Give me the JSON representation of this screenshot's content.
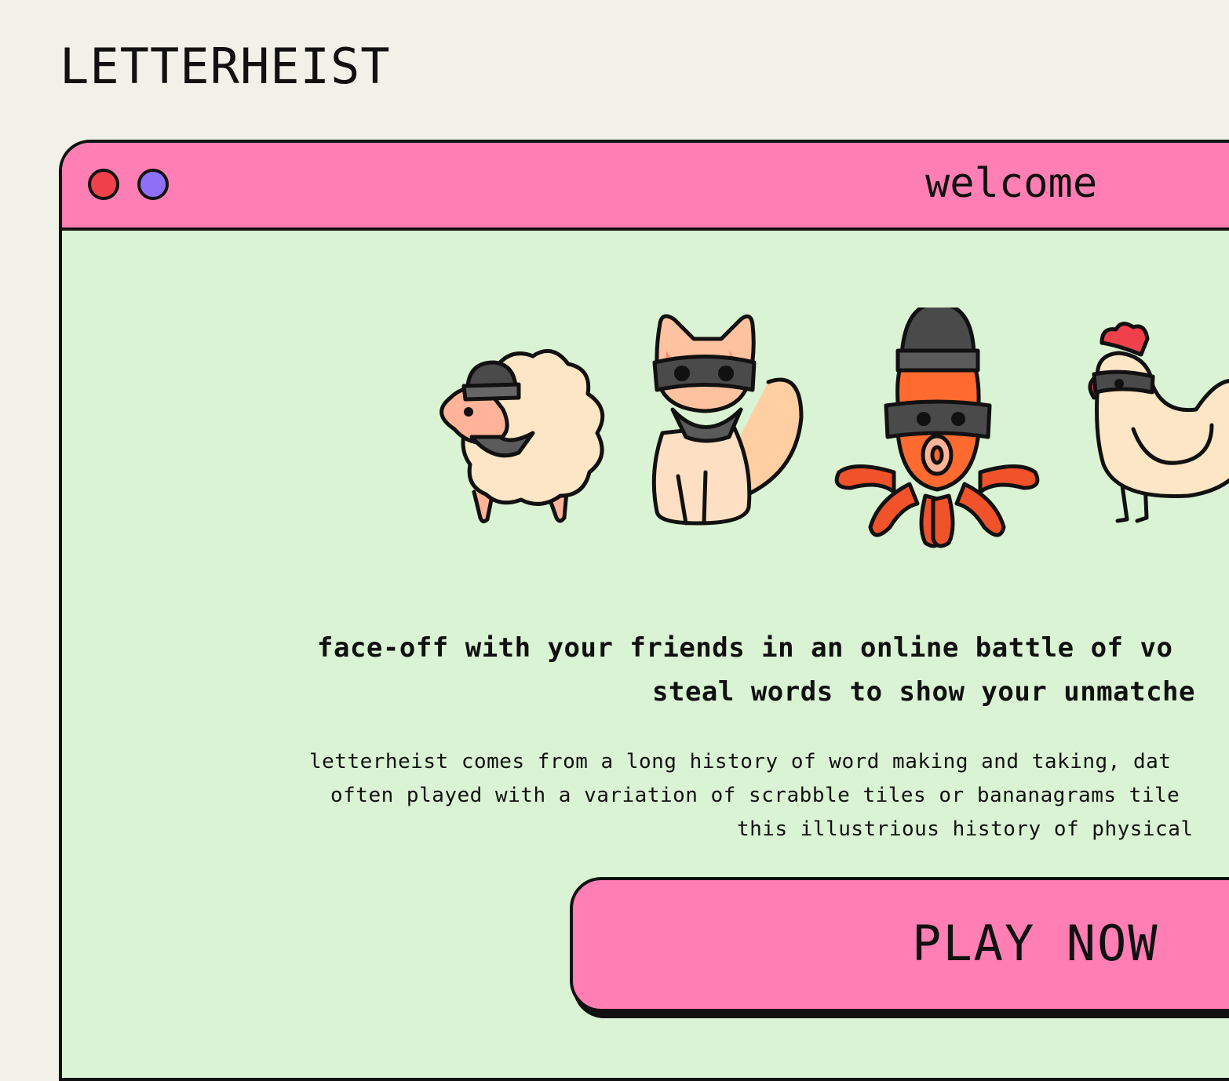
{
  "brand": "LETTERHEIST",
  "window": {
    "title": "welcome",
    "dots": [
      {
        "name": "close",
        "color": "#f0404b"
      },
      {
        "name": "minimize",
        "color": "#8f6ff5"
      }
    ]
  },
  "mascots": [
    "sheep-thief-icon",
    "cat-thief-icon",
    "octopus-thief-icon",
    "chicken-thief-icon"
  ],
  "tagline": {
    "line1": "face-off with your friends in an online battle of vo",
    "line2": "steal words to show your unmatche"
  },
  "description": {
    "line1": "letterheist comes from a long history of word making and taking, dat",
    "line2": "often played with a variation of scrabble tiles or bananagrams tile",
    "line3": "this illustrious history of physical"
  },
  "cta": {
    "label": "PLAY NOW"
  },
  "colors": {
    "background": "#f2f1e9",
    "window_bg": "#daf3d4",
    "accent_pink": "#ff7eb3",
    "outline": "#111111"
  }
}
